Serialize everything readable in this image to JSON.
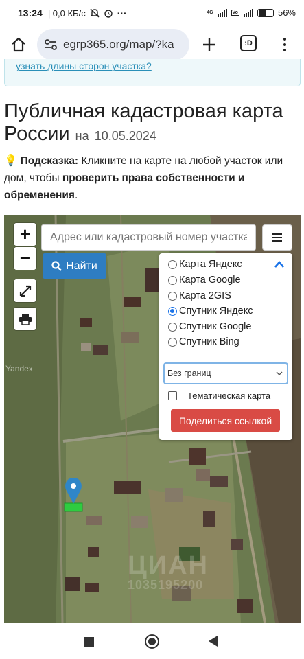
{
  "status_bar": {
    "time": "13:24",
    "network": "0,0 КБ/с",
    "more": "···",
    "lte_label": "4G",
    "volte_label": "Vo",
    "battery": "56%",
    "battery_level": 0.56
  },
  "browser": {
    "url": "egrp365.org/map/?ka",
    "tabs_label": ":D",
    "icons": [
      "home-icon",
      "site-settings-icon",
      "plus-icon",
      "tabs-icon",
      "more-vert-icon"
    ]
  },
  "hint": {
    "link_text": "узнать длины сторон участка?"
  },
  "page": {
    "title": "Публичная кадастровая карта России",
    "date_prefix": "на",
    "date": "10.05.2024",
    "tip_icon": "💡",
    "tip_label": "Подсказка:",
    "tip_text_1": "Кликните на карте на любой участок или дом, чтобы",
    "tip_bold": "проверить права собственности и обременения",
    "tip_end": "."
  },
  "map": {
    "zoom_in": "+",
    "zoom_out": "−",
    "search_placeholder": "Адрес или кадастровый номер участка",
    "find_button": "Найти",
    "watermark": "Yandex",
    "watermark_overlay": "ЦИАН",
    "watermark_overlay_id": "1035195200",
    "layers": [
      {
        "label": "Карта Яндекс",
        "selected": false
      },
      {
        "label": "Карта Google",
        "selected": false
      },
      {
        "label": "Карта 2GIS",
        "selected": false
      },
      {
        "label": "Спутник Яндекс",
        "selected": true
      },
      {
        "label": "Спутник Google",
        "selected": false
      },
      {
        "label": "Спутник Bing",
        "selected": false
      }
    ],
    "borders_select": "Без границ",
    "thematic_checkbox": "Тематическая карта",
    "thematic_checked": false,
    "share_button": "Поделиться ссылкой",
    "colors": {
      "find": "#2e7dc2",
      "share": "#d94b45",
      "marker": "#2f86c8",
      "parcel": "#2ecc40"
    }
  }
}
